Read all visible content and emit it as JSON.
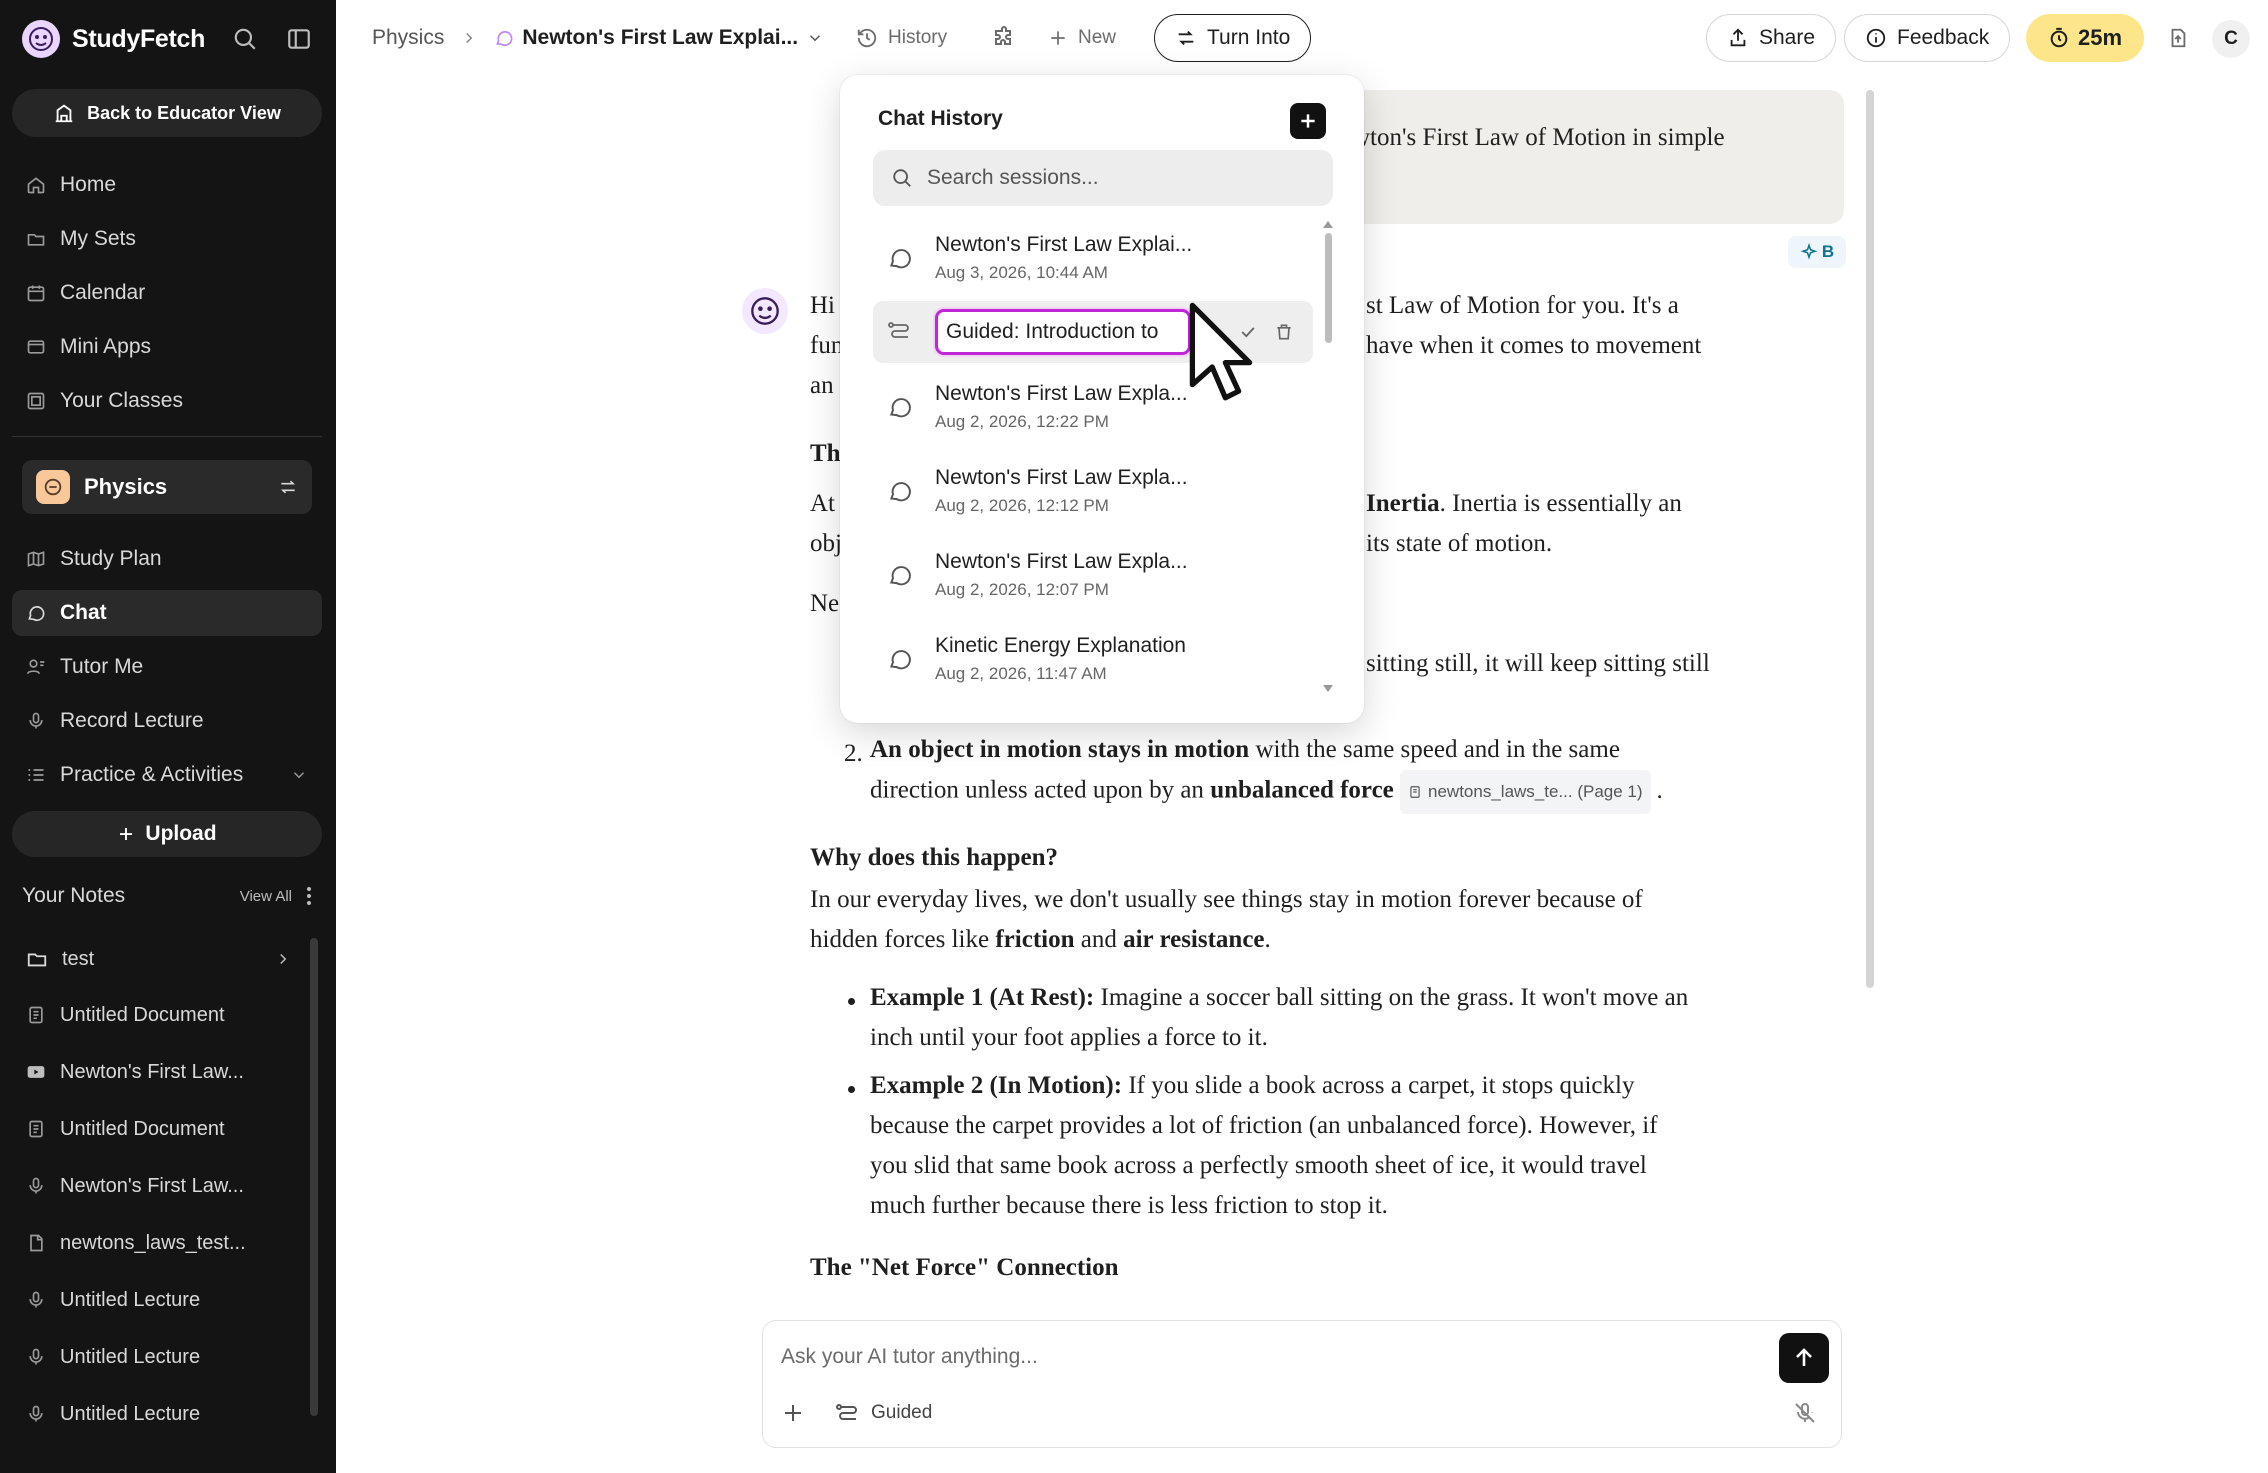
{
  "app": {
    "name": "StudyFetch"
  },
  "sidebar": {
    "back_label": "Back to Educator View",
    "nav": [
      {
        "label": "Home",
        "icon": "home-icon"
      },
      {
        "label": "My Sets",
        "icon": "folder-icon"
      },
      {
        "label": "Calendar",
        "icon": "calendar-icon"
      },
      {
        "label": "Mini Apps",
        "icon": "apps-icon"
      },
      {
        "label": "Your Classes",
        "icon": "classes-icon"
      }
    ],
    "class_name": "Physics",
    "class_nav": [
      {
        "label": "Study Plan",
        "icon": "map-icon"
      },
      {
        "label": "Chat",
        "icon": "chat-bubble-icon",
        "active": true
      },
      {
        "label": "Tutor Me",
        "icon": "tutor-icon"
      },
      {
        "label": "Record Lecture",
        "icon": "microphone-icon"
      },
      {
        "label": "Practice & Activities",
        "icon": "list-icon"
      }
    ],
    "upload_label": "Upload",
    "notes_title": "Your Notes",
    "notes_view_all": "View All",
    "notes": [
      {
        "label": "test",
        "icon": "folder-icon"
      },
      {
        "label": "Untitled Document",
        "icon": "document-icon"
      },
      {
        "label": "Newton's First Law...",
        "icon": "video-icon"
      },
      {
        "label": "Untitled Document",
        "icon": "document-icon"
      },
      {
        "label": "Newton's First Law...",
        "icon": "microphone-icon"
      },
      {
        "label": "newtons_laws_test...",
        "icon": "pdf-icon"
      },
      {
        "label": "Untitled Lecture",
        "icon": "microphone-icon"
      },
      {
        "label": "Untitled Lecture",
        "icon": "microphone-icon"
      },
      {
        "label": "Untitled Lecture",
        "icon": "microphone-icon"
      }
    ]
  },
  "topbar": {
    "breadcrumb_root": "Physics",
    "breadcrumb_current": "Newton's First Law Explai...",
    "history_label": "History",
    "new_label": "New",
    "turn_into_label": "Turn Into",
    "share_label": "Share",
    "feedback_label": "Feedback",
    "timer": "25m",
    "avatar_initial": "C"
  },
  "chat": {
    "user_message_visible": "wton's First Law of Motion in simple",
    "badge": "B",
    "lines": {
      "l1a": "Hi",
      "l1b": "st Law of Motion for you. It's a",
      "l2a": "fun",
      "l2b": "have when it comes to movement",
      "l3a": "an",
      "h1": "Th",
      "l4a": "At",
      "l4b_bold": "Inertia",
      "l4b": ". Inertia is essentially an",
      "l5a": "obj",
      "l5b": "its state of motion.",
      "l6a": "Ne",
      "l7b": "sitting still, it will keep sitting still",
      "item2_num": "2.",
      "item2_bold": "An object in motion stays in motion",
      "item2_rest": " with the same speed and in the same",
      "item2_line2": "direction unless acted upon by an ",
      "item2_bold2": "unbalanced force",
      "citation": "newtons_laws_te... (Page 1)",
      "item2_end": ".",
      "why_heading": "Why does this happen?",
      "why_l1": "In our everyday lives, we don't usually see things stay in motion forever because of",
      "why_l2a": "hidden forces like ",
      "why_l2_friction": "friction",
      "why_l2_and": " and ",
      "why_l2_air": "air resistance",
      "why_l2_end": ".",
      "ex1_label": "Example 1 (At Rest):",
      "ex1_rest": " Imagine a soccer ball sitting on the grass. It won't move an",
      "ex1_l2": "inch until your foot applies a force to it.",
      "ex2_label": "Example 2 (In Motion):",
      "ex2_rest": " If you slide a book across a carpet, it stops quickly",
      "ex2_l2": "because the carpet provides a lot of friction (an unbalanced force). However, if",
      "ex2_l3": "you slid that same book across a perfectly smooth sheet of ice, it would travel",
      "ex2_l4": "much further because there is less friction to stop it.",
      "net_heading": "The \"Net Force\" Connection"
    }
  },
  "input": {
    "placeholder": "Ask your AI tutor anything...",
    "guided_label": "Guided"
  },
  "history_popover": {
    "title": "Chat History",
    "search_placeholder": "Search sessions...",
    "rename_value": "Guided: Introduction to",
    "sessions": [
      {
        "title": "Newton's First Law Explai...",
        "date": "Aug 3, 2026, 10:44 AM"
      },
      {
        "title": "Newton's First Law Expla...",
        "date": "Aug 2, 2026, 12:22 PM"
      },
      {
        "title": "Newton's First Law Expla...",
        "date": "Aug 2, 2026, 12:12 PM"
      },
      {
        "title": "Newton's First Law Expla...",
        "date": "Aug 2, 2026, 12:07 PM"
      },
      {
        "title": "Kinetic Energy Explanation",
        "date": "Aug 2, 2026, 11:47 AM"
      }
    ]
  },
  "colors": {
    "sidebar_bg": "#141414",
    "accent_rename_border": "#c026d3",
    "timer_bg": "#fde68a"
  }
}
